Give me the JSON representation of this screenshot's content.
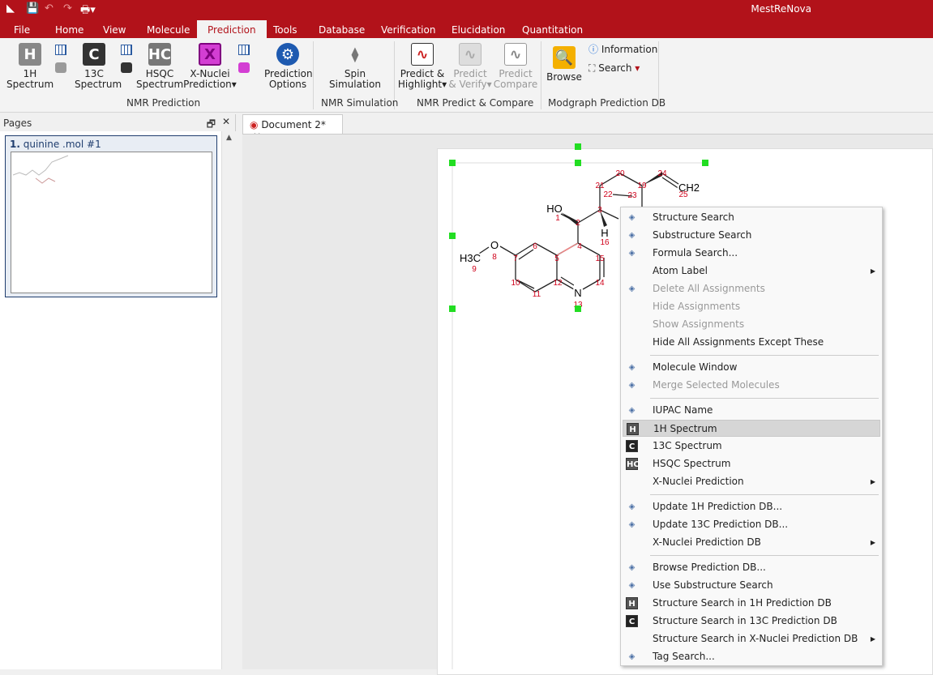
{
  "app": {
    "title": "MestReNova"
  },
  "tabs": [
    "File",
    "Home",
    "View",
    "Molecule",
    "Prediction",
    "Tools",
    "Database",
    "Verification",
    "Elucidation",
    "Quantitation"
  ],
  "active_tab": "Prediction",
  "ribbon": {
    "buttons": [
      {
        "label1": "1H",
        "label2": "Spectrum",
        "icon": "1h-spectrum-icon"
      },
      {
        "label1": "13C",
        "label2": "Spectrum",
        "icon": "13c-spectrum-icon"
      },
      {
        "label1": "HSQC",
        "label2": "Spectrum",
        "icon": "hsqc-spectrum-icon"
      },
      {
        "label1": "X-Nuclei",
        "label2": "Prediction▾",
        "icon": "x-nuclei-icon"
      },
      {
        "label1": "Prediction",
        "label2": "Options",
        "icon": "prediction-options-icon"
      },
      {
        "label1": "Spin",
        "label2": "Simulation",
        "icon": "spin-icon"
      },
      {
        "label1": "Predict &",
        "label2": "Highlight▾",
        "icon": "predict-highlight-icon"
      },
      {
        "label1": "Predict",
        "label2": "& Verify▾",
        "icon": "predict-verify-icon",
        "disabled": true
      },
      {
        "label1": "Predict",
        "label2": "Compare",
        "icon": "predict-compare-icon",
        "disabled": true
      },
      {
        "label1": "Browse",
        "label2": "",
        "icon": "browse-icon"
      }
    ],
    "information": "Information",
    "search": "Search",
    "groups": [
      "NMR Prediction",
      "NMR Simulation",
      "NMR Predict & Compare",
      "Modgraph Prediction DB"
    ]
  },
  "pages": {
    "title": "Pages",
    "item": "quinine .mol #1",
    "item_num": "1."
  },
  "document": {
    "tab": "Document 2*"
  },
  "molecule": {
    "atoms": [
      "HO",
      "1",
      "2",
      "3",
      "4",
      "5",
      "6",
      "7",
      "O",
      "8",
      "H3C",
      "9",
      "10",
      "11",
      "12",
      "N",
      "13",
      "14",
      "15",
      "H",
      "16",
      "19",
      "20",
      "21",
      "22",
      "23",
      "24",
      "CH2",
      "25"
    ]
  },
  "context_menu": [
    {
      "label": "Structure Search",
      "icon": "structure-search-icon"
    },
    {
      "label": "Substructure Search",
      "icon": "substructure-search-icon"
    },
    {
      "label": "Formula Search...",
      "icon": "formula-search-icon"
    },
    {
      "label": "Atom Label",
      "submenu": true
    },
    {
      "label": "Delete All Assignments",
      "disabled": true,
      "icon": "delete-icon"
    },
    {
      "label": "Hide Assignments",
      "disabled": true
    },
    {
      "label": "Show Assignments",
      "disabled": true
    },
    {
      "label": "Hide All Assignments Except These",
      "sep_after": true
    },
    {
      "label": "Molecule Window",
      "icon": "molecule-window-icon"
    },
    {
      "label": "Merge Selected Molecules",
      "disabled": true,
      "icon": "merge-icon",
      "sep_after": true
    },
    {
      "label": "IUPAC Name",
      "icon": "iupac-icon"
    },
    {
      "label": "1H Spectrum",
      "icon": "1h-icon",
      "highlighted": true
    },
    {
      "label": "13C Spectrum",
      "icon": "13c-icon"
    },
    {
      "label": "HSQC Spectrum",
      "icon": "hsqc-icon"
    },
    {
      "label": "X-Nuclei Prediction",
      "submenu": true,
      "sep_after": true
    },
    {
      "label": "Update 1H Prediction DB...",
      "icon": "update-1h-db-icon"
    },
    {
      "label": "Update 13C Prediction DB...",
      "icon": "update-13c-db-icon"
    },
    {
      "label": "X-Nuclei Prediction DB",
      "submenu": true,
      "sep_after": true
    },
    {
      "label": "Browse Prediction DB...",
      "icon": "browse-db-icon"
    },
    {
      "label": "Use Substructure Search",
      "icon": "use-substructure-icon"
    },
    {
      "label": "Structure Search in 1H Prediction DB",
      "icon": "1h-icon"
    },
    {
      "label": "Structure Search in 13C Prediction DB",
      "icon": "13c-icon"
    },
    {
      "label": "Structure Search in X-Nuclei Prediction DB",
      "submenu": true
    },
    {
      "label": "Tag Search...",
      "icon": "tag-search-icon"
    }
  ],
  "colors": {
    "brand": "#b2121a",
    "atom_number": "#d0021b",
    "handle": "#22dd22"
  }
}
